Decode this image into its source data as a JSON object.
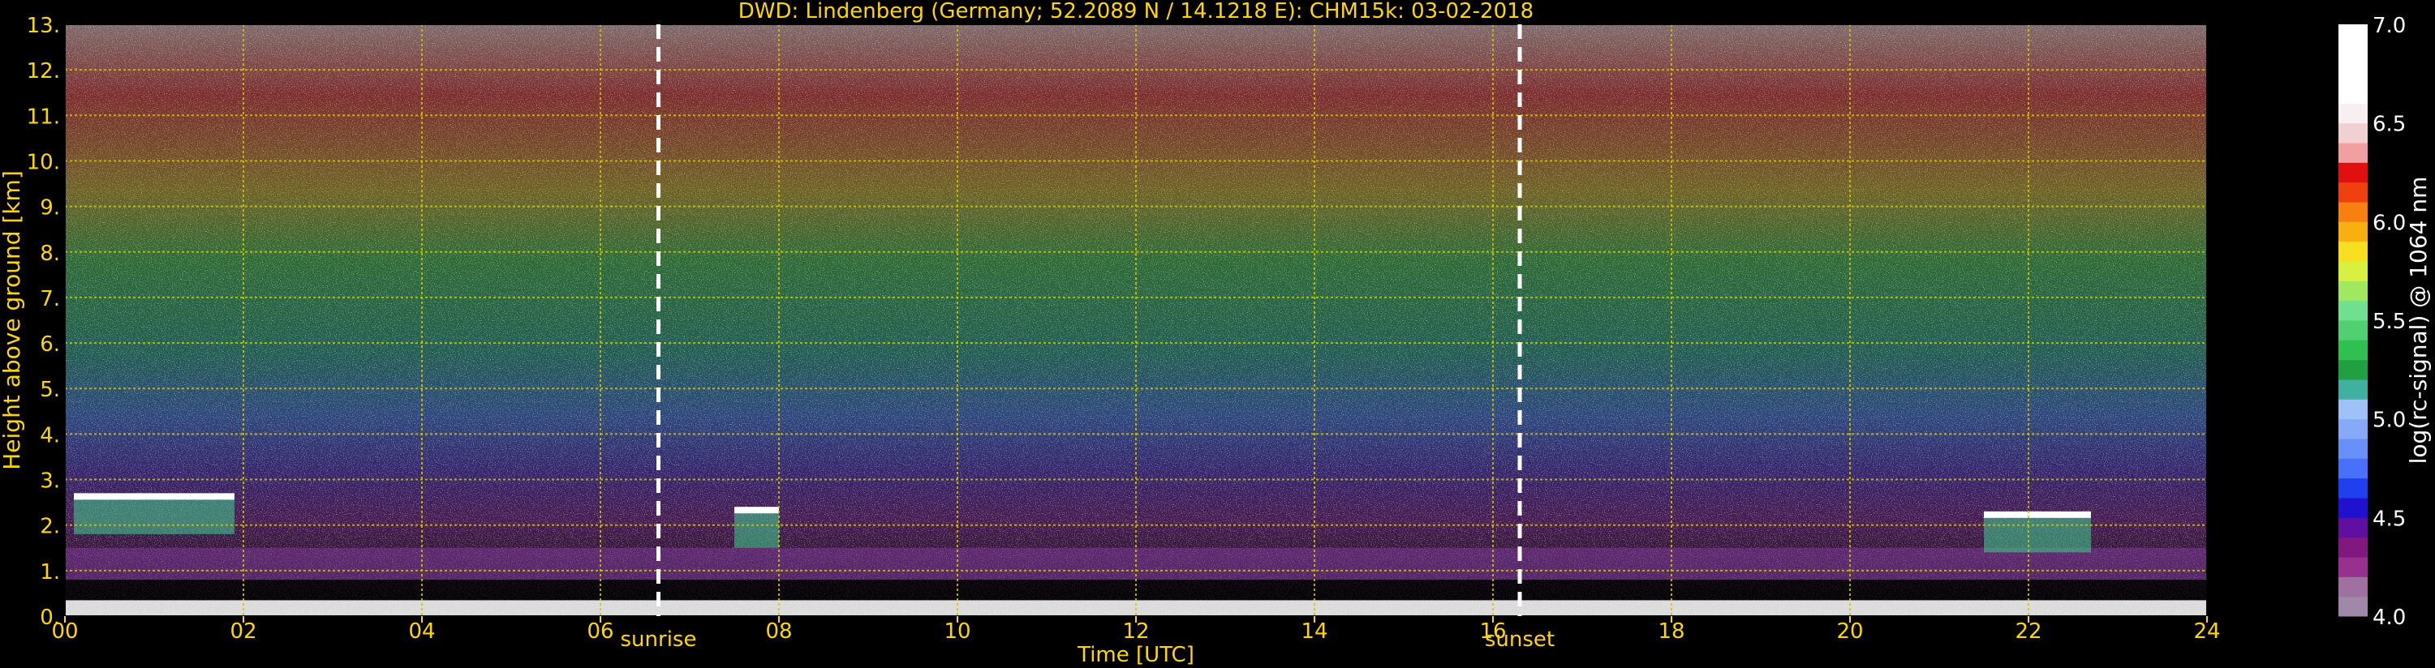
{
  "chart_data": {
    "type": "heatmap",
    "title": "DWD: Lindenberg (Germany; 52.2089 N / 14.1218 E):    CHM15k: 03-02-2018",
    "xlabel": "Time [UTC]",
    "ylabel": "Height above ground [km]",
    "xlim": [
      0,
      24
    ],
    "ylim": [
      0,
      13
    ],
    "x_ticks": [
      "00",
      "02",
      "04",
      "06",
      "08",
      "10",
      "12",
      "14",
      "16",
      "18",
      "20",
      "22",
      "24"
    ],
    "y_ticks": [
      "0.",
      "1.",
      "2.",
      "3.",
      "4.",
      "5.",
      "6.",
      "7.",
      "8.",
      "9.",
      "10.",
      "11.",
      "12.",
      "13."
    ],
    "grid": true,
    "markers": [
      {
        "label": "sunrise",
        "x": 6.65
      },
      {
        "label": "sunset",
        "x": 16.3
      }
    ],
    "colorbar": {
      "label": "log(rc-signal) @ 1064 nm",
      "range": [
        4.0,
        7.0
      ],
      "ticks": [
        "4.0",
        "4.5",
        "5.0",
        "5.5",
        "6.0",
        "6.5",
        "7.0"
      ]
    }
  },
  "colors": {
    "background": "#000000",
    "text": "#ffd700",
    "grid": "#d4c400",
    "marker": "#ffffff",
    "colorbar_label": "#ffffff"
  }
}
